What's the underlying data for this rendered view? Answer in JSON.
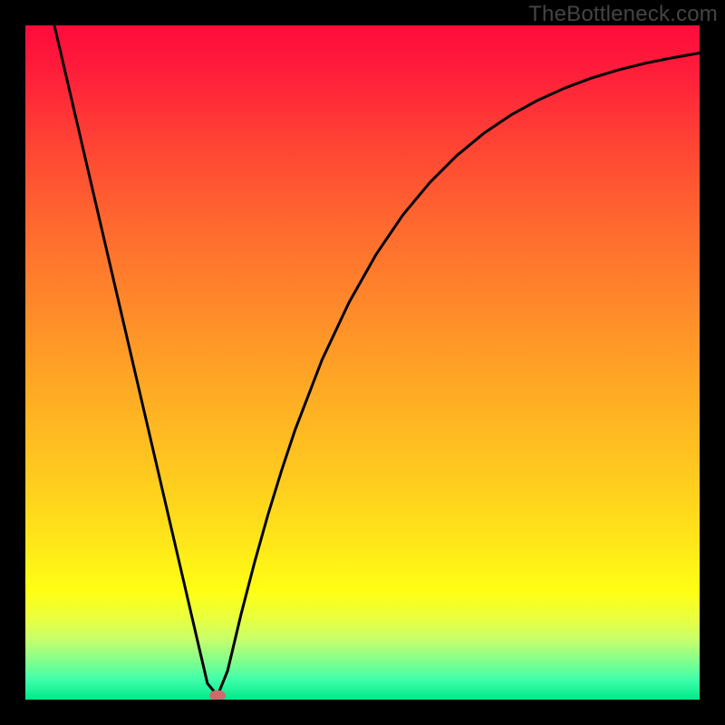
{
  "watermark": "TheBottleneck.com",
  "colors": {
    "page_bg": "#000000",
    "watermark": "#444444",
    "curve_stroke": "#000000",
    "marker_fill": "#cf6a6a",
    "gradient_stops": [
      {
        "pos": 0,
        "hex": "#ff0b3b"
      },
      {
        "pos": 6,
        "hex": "#ff1b3b"
      },
      {
        "pos": 18,
        "hex": "#ff4534"
      },
      {
        "pos": 30,
        "hex": "#ff6a2f"
      },
      {
        "pos": 42,
        "hex": "#ff8a2a"
      },
      {
        "pos": 54,
        "hex": "#ffaa24"
      },
      {
        "pos": 66,
        "hex": "#ffc81f"
      },
      {
        "pos": 76,
        "hex": "#ffe41a"
      },
      {
        "pos": 84,
        "hex": "#ffff14"
      },
      {
        "pos": 88,
        "hex": "#e8ff40"
      },
      {
        "pos": 91,
        "hex": "#c8ff6a"
      },
      {
        "pos": 94,
        "hex": "#88ff8a"
      },
      {
        "pos": 97,
        "hex": "#40ffaa"
      },
      {
        "pos": 100,
        "hex": "#00e88a"
      }
    ]
  },
  "chart_data": {
    "type": "line",
    "title": "",
    "xlabel": "",
    "ylabel": "",
    "xlim": [
      0,
      100
    ],
    "ylim": [
      0,
      100
    ],
    "grid": false,
    "series": [
      {
        "name": "bottleneck-curve",
        "x": [
          4.3,
          6,
          8,
          10,
          12,
          14,
          16,
          18,
          20,
          22,
          24,
          26,
          27,
          28.5,
          30,
          32,
          34,
          36,
          38,
          40,
          44,
          48,
          52,
          56,
          60,
          64,
          68,
          72,
          76,
          80,
          84,
          88,
          92,
          96,
          100
        ],
        "y": [
          100,
          92.7,
          84.1,
          75.5,
          66.9,
          58.3,
          49.7,
          41.1,
          32.5,
          23.9,
          15.3,
          6.7,
          2.4,
          0.6,
          4.3,
          12.7,
          20.4,
          27.5,
          34.0,
          40.0,
          50.4,
          58.9,
          66.0,
          71.9,
          76.7,
          80.7,
          84.0,
          86.7,
          88.9,
          90.7,
          92.2,
          93.4,
          94.4,
          95.2,
          95.9
        ]
      }
    ],
    "annotations": [
      {
        "name": "min-marker",
        "x": 28.5,
        "y": 0.6
      }
    ]
  }
}
